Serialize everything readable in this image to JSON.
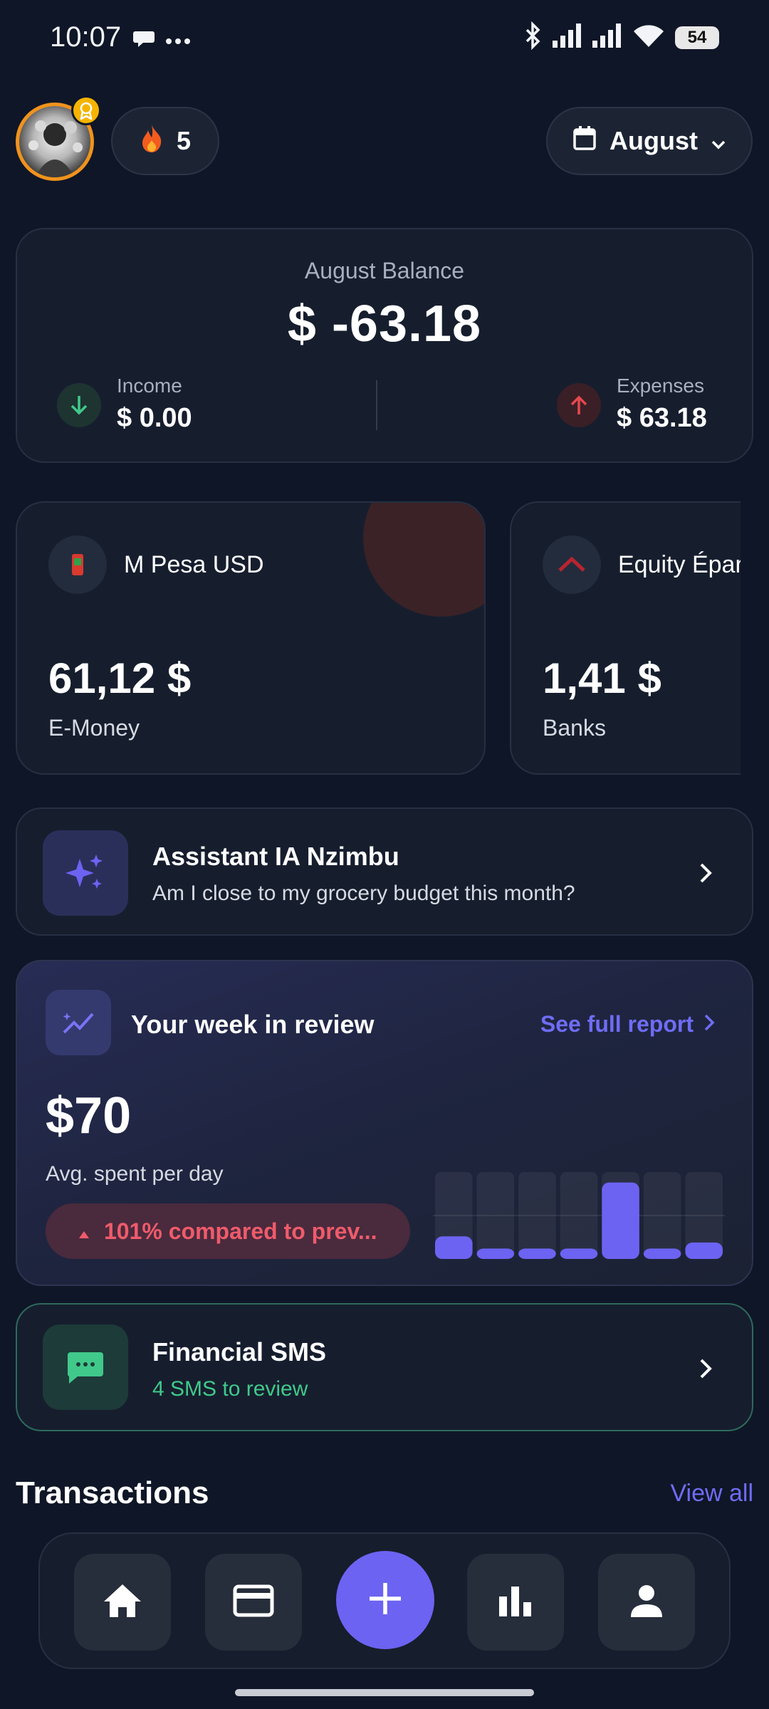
{
  "status_bar": {
    "time": "10:07",
    "battery": "54",
    "icons": [
      "message-icon",
      "more-dots-icon",
      "bluetooth-icon",
      "signal-icon",
      "signal-icon",
      "wifi-icon",
      "battery-icon"
    ]
  },
  "header": {
    "streak_count": "5",
    "streak_icon": "fire-icon",
    "month_label": "August",
    "month_icon": "calendar-icon"
  },
  "balance": {
    "title": "August Balance",
    "amount": "$ -63.18",
    "income_label": "Income",
    "income_value": "$ 0.00",
    "expenses_label": "Expenses",
    "expenses_value": "$ 63.18",
    "income_color": "#40c98a",
    "expenses_color": "#e5484d"
  },
  "accounts": [
    {
      "name": "M Pesa USD",
      "amount": "61,12 $",
      "type": "E-Money"
    },
    {
      "name": "Equity Éparg",
      "amount": "1,41 $",
      "type": "Banks"
    }
  ],
  "assistant": {
    "title": "Assistant IA Nzimbu",
    "subtitle": "Am I close to my grocery budget this month?"
  },
  "week_review": {
    "title": "Your week in review",
    "link": "See full report",
    "amount": "$70",
    "subtitle": "Avg. spent per day",
    "comparison": "101% compared to prev...",
    "accent_color": "#6c63f2"
  },
  "chart_data": {
    "type": "bar",
    "categories": [
      "1",
      "2",
      "3",
      "4",
      "5",
      "6",
      "7"
    ],
    "values": [
      0.26,
      0.12,
      0.12,
      0.12,
      0.88,
      0.12,
      0.19
    ],
    "ylim": [
      0,
      1
    ],
    "title": "",
    "xlabel": "",
    "ylabel": "",
    "grid": true
  },
  "sms": {
    "title": "Financial SMS",
    "subtitle": "4 SMS to review"
  },
  "transactions": {
    "title": "Transactions",
    "view_all": "View all"
  },
  "bottom_nav": {
    "items": [
      "home-icon",
      "card-icon",
      "add-icon",
      "chart-icon",
      "profile-icon"
    ]
  }
}
